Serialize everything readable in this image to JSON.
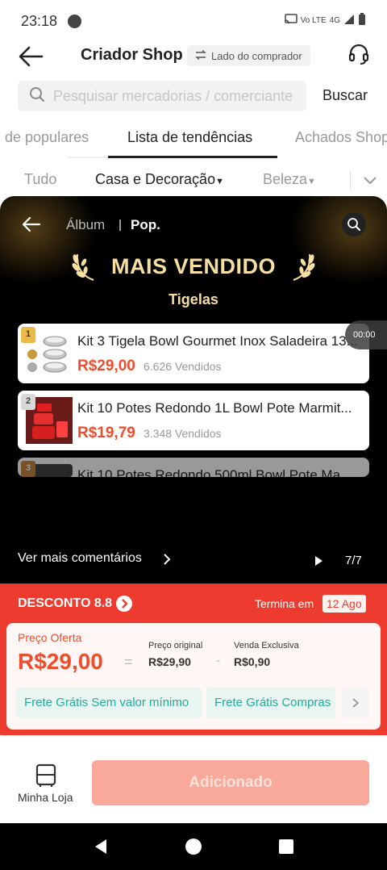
{
  "status_bar": {
    "time": "23:18",
    "network": "Vo LTE",
    "signal": "4G"
  },
  "header": {
    "title": "Criador Shop",
    "buyer_side_label": "Lado do comprador"
  },
  "search": {
    "placeholder": "Pesquisar mercadorias / comerciante",
    "button_label": "Buscar"
  },
  "tabs": [
    "de populares",
    "Lista de tendências",
    "Achados Shop"
  ],
  "categories": {
    "all": "Tudo",
    "home": "Casa e Decoração",
    "beauty": "Beleza"
  },
  "album": {
    "album_label": "Álbum",
    "pop_label": "Pop.",
    "title": "MAIS VENDIDO",
    "subtitle": "Tigelas",
    "timer": "00:00",
    "products": [
      {
        "rank": "1",
        "name": "Kit 3 Tigela Bowl Gourmet Inox Saladeira 13...",
        "price": "R$29,00",
        "sold": "6.626 Vendidos"
      },
      {
        "rank": "2",
        "name": "Kit 10 Potes Redondo 1L Bowl  Pote Marmit...",
        "price": "R$19,79",
        "sold": "3.348 Vendidos"
      },
      {
        "rank": "3",
        "name": "Kit 10 Potes Redondo 500ml Bowl  Pote Ma...",
        "price": "",
        "sold": ""
      }
    ],
    "more_comments": "Ver mais comentários",
    "page_count": "7/7"
  },
  "discount": {
    "title": "DESCONTO 8.8",
    "ends_in_label": "Termina em",
    "ends_date": "12 Ago",
    "offer_label": "Preço Oferta",
    "offer_price": "R$29,00",
    "original_label": "Preço original",
    "original_price": "R$29,90",
    "exclusive_label": "Venda Exclusiva",
    "exclusive_price": "R$0,90",
    "chips": [
      "Frete Grátis Sem valor mínimo",
      "Frete Grátis Compras"
    ]
  },
  "bottom": {
    "store_label": "Minha Loja",
    "add_button": "Adicionado"
  },
  "colors": {
    "accent": "#ee4d2d",
    "banner": "#ee3b2f",
    "gold": "#f6dfa0",
    "teal": "#26aa99"
  }
}
